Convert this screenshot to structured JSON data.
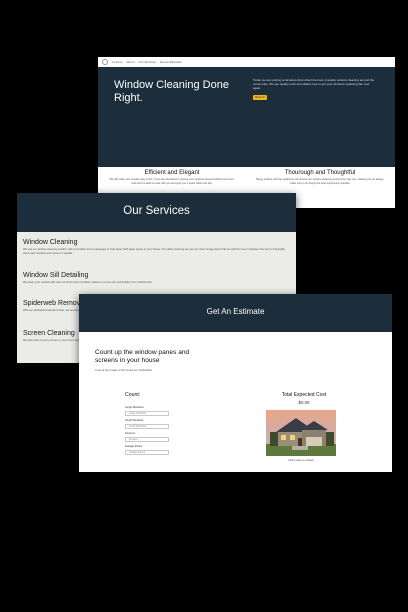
{
  "colors": {
    "navy": "#1c2d3b",
    "accent": "#f2b51c",
    "page_bg": "#000000"
  },
  "home": {
    "nav_items": [
      "1 Home",
      "Room",
      "Our Services",
      "Get An Estimate"
    ],
    "hero_title": "Window Cleaning Done Right.",
    "hero_text": "Today we are looking at windows that reflect the best of quality window cleaning around the community. We use quality tools and skilled care to get your windows sparkling like new again.",
    "hero_button": "Book Us",
    "features": [
      {
        "title": "Efficient and Elegant",
        "text": "We will make sure streaks stay in line. If you are interested in getting your windows cleaned within two hours, and we’ll be able to meet with you and give you a quote within the day."
      },
      {
        "title": "Thourough and Thoughtful",
        "text": "Being positive that the neighbors will receive our window cleaning service from day one, cleaning as we always make sure to do things the best experience possible."
      }
    ]
  },
  "services": {
    "title": "Our Services",
    "items": [
      {
        "title": "Window Cleaning",
        "text": "We use our window cleaning solution with a scrubber and a squeegee to help clean both glass panes in your house. For safety cleaning we use our clean image water that we will then use in between the two to thoroughly clean each window and screen to sparkle."
      },
      {
        "title": "Window Sill Detailing",
        "text": "We clean your window sills with our brush and microfiber towels to remove dirt and buildup from window sills."
      },
      {
        "title": "Spiderweb Removal",
        "text": "With our dedicated extender brush, we remove webs from the corners around your windows."
      },
      {
        "title": "Screen Cleaning",
        "text": "We take care of every screen in your home using our soft brush."
      }
    ]
  },
  "estimate": {
    "title": "Get An Estimate",
    "intro_title": "Count up the window panes and screens in your house",
    "intro_sub": "Look at the image of the house for clarification.",
    "count_title": "Count:",
    "fields": [
      {
        "label": "Large Windows:",
        "placeholder": "Large Windows"
      },
      {
        "label": "Small Windows:",
        "placeholder": "Small Windows"
      },
      {
        "label": "Screens:",
        "placeholder": "Screens"
      },
      {
        "label": "Garage Panes:",
        "placeholder": "Garage Panes"
      }
    ],
    "total_title": "Total Expected Cost",
    "total_value": "$0.00",
    "image_caption": "Click image to enlarge"
  }
}
